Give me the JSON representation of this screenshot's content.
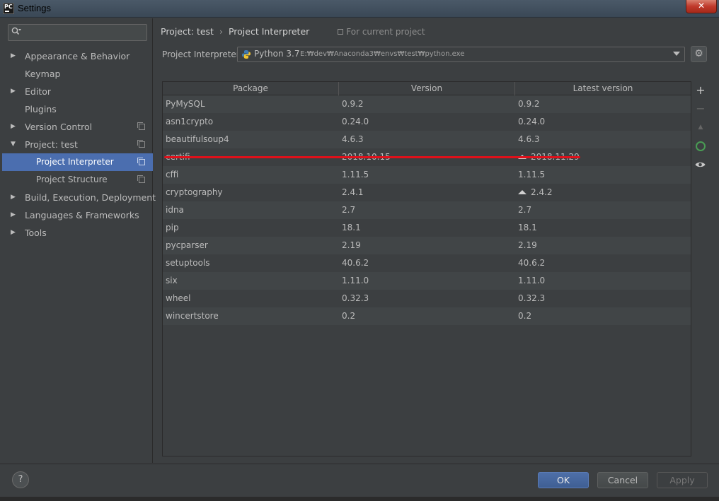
{
  "window": {
    "title": "Settings",
    "app_icon_text": "PC",
    "close_label": "✕"
  },
  "sidebar": {
    "search": {
      "value": "",
      "placeholder": ""
    },
    "items": [
      {
        "label": "Appearance & Behavior",
        "expandable": true,
        "expanded": false
      },
      {
        "label": "Keymap",
        "expandable": false
      },
      {
        "label": "Editor",
        "expandable": true,
        "expanded": false
      },
      {
        "label": "Plugins",
        "expandable": false
      },
      {
        "label": "Version Control",
        "expandable": true,
        "expanded": false,
        "copy_icon": true
      },
      {
        "label": "Project: test",
        "expandable": true,
        "expanded": true,
        "copy_icon": true
      },
      {
        "label": "Project Interpreter",
        "child": true,
        "selected": true,
        "copy_icon": true
      },
      {
        "label": "Project Structure",
        "child": true,
        "copy_icon": true
      },
      {
        "label": "Build, Execution, Deployment",
        "expandable": true,
        "expanded": false
      },
      {
        "label": "Languages & Frameworks",
        "expandable": true,
        "expanded": false
      },
      {
        "label": "Tools",
        "expandable": true,
        "expanded": false
      }
    ]
  },
  "header": {
    "breadcrumb": [
      "Project: test",
      "Project Interpreter"
    ],
    "separator": "›",
    "scope_label": "For current project"
  },
  "interpreter": {
    "label": "Project Interpreter:",
    "name": "Python 3.7",
    "path": "E:₩dev₩Anaconda3₩envs₩test₩python.exe"
  },
  "table": {
    "columns": [
      "Package",
      "Version",
      "Latest version"
    ],
    "rows": [
      {
        "package": "PyMySQL",
        "version": "0.9.2",
        "latest": "0.9.2",
        "upgrade": false
      },
      {
        "package": "asn1crypto",
        "version": "0.24.0",
        "latest": "0.24.0",
        "upgrade": false
      },
      {
        "package": "beautifulsoup4",
        "version": "4.6.3",
        "latest": "4.6.3",
        "upgrade": false,
        "highlighted": true
      },
      {
        "package": "certifi",
        "version": "2018.10.15",
        "latest": "2018.11.29",
        "upgrade": true
      },
      {
        "package": "cffi",
        "version": "1.11.5",
        "latest": "1.11.5",
        "upgrade": false
      },
      {
        "package": "cryptography",
        "version": "2.4.1",
        "latest": "2.4.2",
        "upgrade": true
      },
      {
        "package": "idna",
        "version": "2.7",
        "latest": "2.7",
        "upgrade": false
      },
      {
        "package": "pip",
        "version": "18.1",
        "latest": "18.1",
        "upgrade": false
      },
      {
        "package": "pycparser",
        "version": "2.19",
        "latest": "2.19",
        "upgrade": false
      },
      {
        "package": "setuptools",
        "version": "40.6.2",
        "latest": "40.6.2",
        "upgrade": false
      },
      {
        "package": "six",
        "version": "1.11.0",
        "latest": "1.11.0",
        "upgrade": false
      },
      {
        "package": "wheel",
        "version": "0.32.3",
        "latest": "0.32.3",
        "upgrade": false
      },
      {
        "package": "wincertstore",
        "version": "0.2",
        "latest": "0.2",
        "upgrade": false
      }
    ]
  },
  "toolbar": {
    "add": "+",
    "remove": "−",
    "upgrade": "▲"
  },
  "footer": {
    "help": "?",
    "ok": "OK",
    "cancel": "Cancel",
    "apply": "Apply"
  },
  "colors": {
    "background": "#3c3f41",
    "selection": "#4b6eaf",
    "annotation_underline": "#e0101a",
    "upgrade_green": "#499c54"
  }
}
